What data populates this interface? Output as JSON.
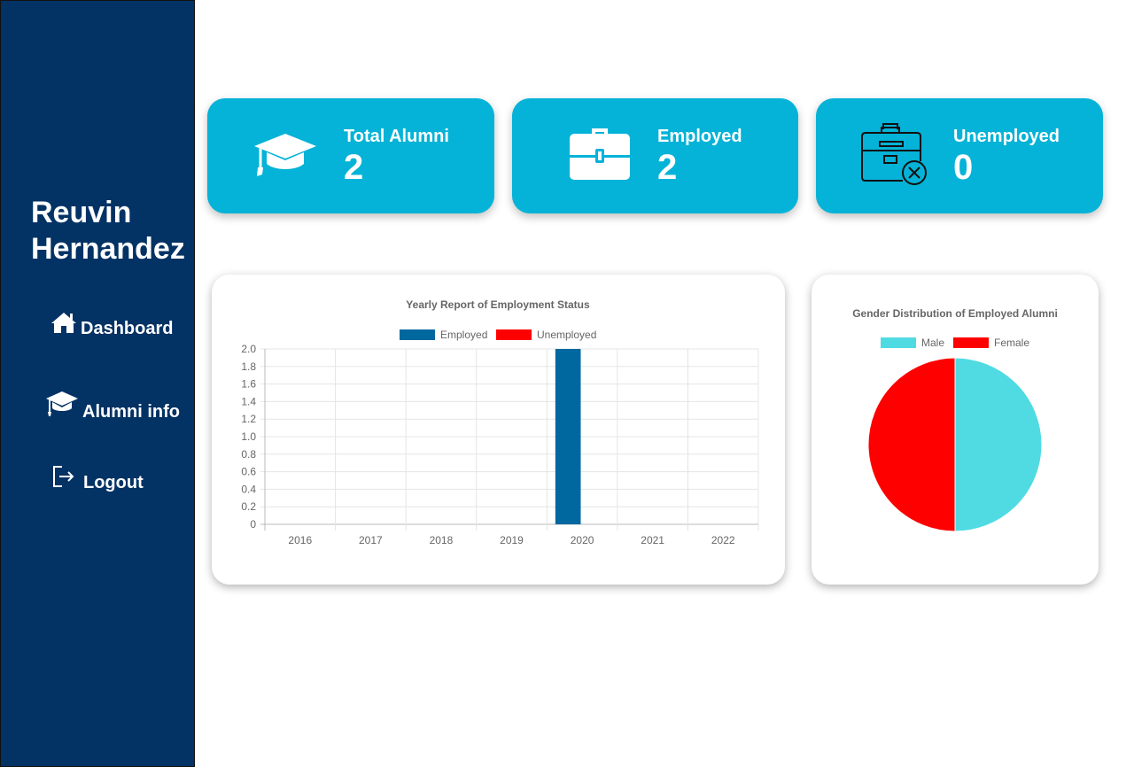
{
  "sidebar": {
    "user_name": "Reuvin Hernandez",
    "nav": [
      {
        "label": "Dashboard",
        "icon": "home-icon"
      },
      {
        "label": "Alumni info",
        "icon": "graduation-cap-icon"
      },
      {
        "label": "Logout",
        "icon": "logout-icon"
      }
    ]
  },
  "stats": [
    {
      "label": "Total Alumni",
      "value": "2",
      "icon": "graduation-cap-icon"
    },
    {
      "label": "Employed",
      "value": "2",
      "icon": "briefcase-icon"
    },
    {
      "label": "Unemployed",
      "value": "0",
      "icon": "briefcase-x-icon"
    }
  ],
  "colors": {
    "sidebar_bg": "#033264",
    "card_bg": "#04b3d7",
    "employed": "#01689f",
    "unemployed": "#ff0000",
    "male": "#50dbe3",
    "female": "#ff0000"
  },
  "chart_data": [
    {
      "type": "bar",
      "title": "Yearly Report of Employment Status",
      "categories": [
        "2016",
        "2017",
        "2018",
        "2019",
        "2020",
        "2021",
        "2022"
      ],
      "series": [
        {
          "name": "Employed",
          "values": [
            0,
            0,
            0,
            0,
            2,
            0,
            0
          ],
          "color": "#01689f"
        },
        {
          "name": "Unemployed",
          "values": [
            0,
            0,
            0,
            0,
            0,
            0,
            0
          ],
          "color": "#ff0000"
        }
      ],
      "ylim": [
        0,
        2
      ],
      "yticks": [
        "2.0",
        "1.8",
        "1.6",
        "1.4",
        "1.2",
        "1.0",
        "0.8",
        "0.6",
        "0.4",
        "0.2",
        "0"
      ],
      "legend": "top",
      "grid": true
    },
    {
      "type": "pie",
      "title": "Gender Distribution of Employed Alumni",
      "categories": [
        "Male",
        "Female"
      ],
      "values": [
        1,
        1
      ],
      "colors": [
        "#50dbe3",
        "#ff0000"
      ],
      "legend": "top"
    }
  ]
}
